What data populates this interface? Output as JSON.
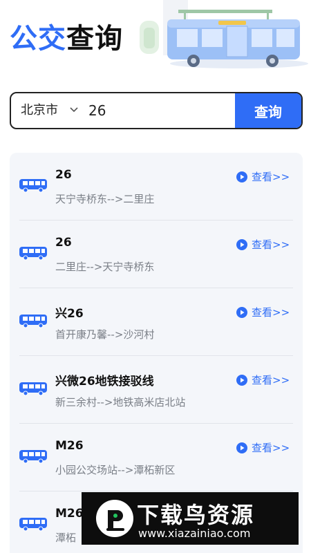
{
  "header": {
    "title_part1": "公交",
    "title_part2": "查询"
  },
  "search": {
    "city": "北京市",
    "query_value": "26",
    "button_label": "查询"
  },
  "results": [
    {
      "name": "26",
      "direction": "天宁寺桥东-->二里庄",
      "view_label": "查看>>"
    },
    {
      "name": "26",
      "direction": "二里庄-->天宁寺桥东",
      "view_label": "查看>>"
    },
    {
      "name": "兴26",
      "direction": "首开康乃馨-->沙河村",
      "view_label": "查看>>"
    },
    {
      "name": "兴微26地铁接驳线",
      "direction": "新三余村-->地铁高米店北站",
      "view_label": "查看>>"
    },
    {
      "name": "M26",
      "direction": "小园公交场站-->潭柘新区",
      "view_label": "查看>>"
    },
    {
      "name": "M26",
      "direction": "潭柘",
      "view_label": ""
    }
  ],
  "watermark": {
    "title": "下载鸟资源",
    "url": "www.xiazainiao.com"
  },
  "colors": {
    "accent": "#2f6df6",
    "title_dark": "#111111",
    "list_bg": "#f4f6fa",
    "muted_text": "#7a7f87"
  }
}
